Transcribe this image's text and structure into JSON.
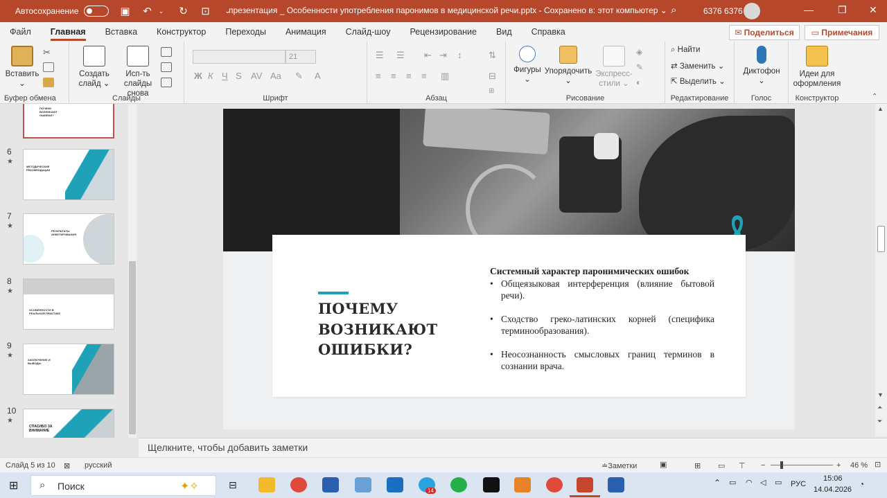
{
  "titlebar": {
    "autosave_label": "Автосохранение",
    "document_title": "презентация _ Особенности употребления паронимов в медицинской речи.pptx  -  Сохранено в: этот компьютер  ⌄",
    "user_name": "6376 6376"
  },
  "tabs": [
    "Файл",
    "Главная",
    "Вставка",
    "Конструктор",
    "Переходы",
    "Анимация",
    "Слайд-шоу",
    "Рецензирование",
    "Вид",
    "Справка"
  ],
  "actions": {
    "share": "Поделиться",
    "comments": "Примечания"
  },
  "ribbon": {
    "clipboard": {
      "paste": "Вставить",
      "group": "Буфер обмена"
    },
    "slides": {
      "new_slide_l1": "Создать",
      "new_slide_l2": "слайд ⌄",
      "reuse_l1": "Исп-ть",
      "reuse_l2": "слайды снова",
      "group": "Слайды"
    },
    "font": {
      "size": "21",
      "group": "Шрифт"
    },
    "paragraph": {
      "group": "Абзац"
    },
    "drawing": {
      "shapes": "Фигуры",
      "arrange": "Упорядочить",
      "quick_styles_l1": "Экспресс-",
      "quick_styles_l2": "стили ⌄",
      "group": "Рисование"
    },
    "editing": {
      "find": "Найти",
      "replace": "Заменить",
      "select": "Выделить",
      "group": "Редактирование"
    },
    "voice": {
      "dictate": "Диктофон",
      "group": "Голос"
    },
    "designer": {
      "ideas_l1": "Идеи для",
      "ideas_l2": "оформления",
      "group": "Конструктор"
    }
  },
  "thumbnails": [
    {
      "number": "6",
      "star": "★"
    },
    {
      "number": "7",
      "star": "★"
    },
    {
      "number": "8",
      "star": "★"
    },
    {
      "number": "9",
      "star": "★"
    },
    {
      "number": "10",
      "star": "★"
    }
  ],
  "thumb_texts": {
    "t5": "ПОЧЕМУ ВОЗНИКАЮТ ОШИБКИ?",
    "t6": "МЕТОДИЧЕСКИЕ РЕКОМЕНДАЦИИ",
    "t7": "РЕЗУЛЬТАТЫ АНКЕТИРОВАНИЯ",
    "t8": "ОСОБЕННОСТИ В РЕАЛЬНОЙ ПРАКТИКЕ",
    "t9": "ЗАКЛЮЧЕНИЕ И ВЫВОДЫ",
    "t10": "СПАСИБО ЗА ВНИМАНИЕ"
  },
  "slide": {
    "heading_l1": "ПОЧЕМУ",
    "heading_l2": "ВОЗНИКАЮТ",
    "heading_l3": "ОШИБКИ?",
    "body_title": "Системный характер паронимических ошибок",
    "bullets": [
      "Общеязыковая интерференция (влияние бытовой речи).",
      "Сходство греко-латинских корней (специфика терминообразования).",
      "Неосознанность смысловых границ терминов в сознании врача."
    ],
    "bullet_mark": "•",
    "accent_color": "#1fa1b8"
  },
  "notes_placeholder": "Щелкните, чтобы добавить заметки",
  "status": {
    "slide_info": "Слайд 5 из 10",
    "language": "русский",
    "notes_btn": "Заметки",
    "zoom": "46 %"
  },
  "taskbar": {
    "search_placeholder": "Поиск",
    "telegram_badge": "14",
    "lang": "РУС",
    "time": "15:06",
    "date": "14.04.2026"
  },
  "colors": {
    "brand": "#b7472a",
    "accent": "#1fa1b8"
  }
}
